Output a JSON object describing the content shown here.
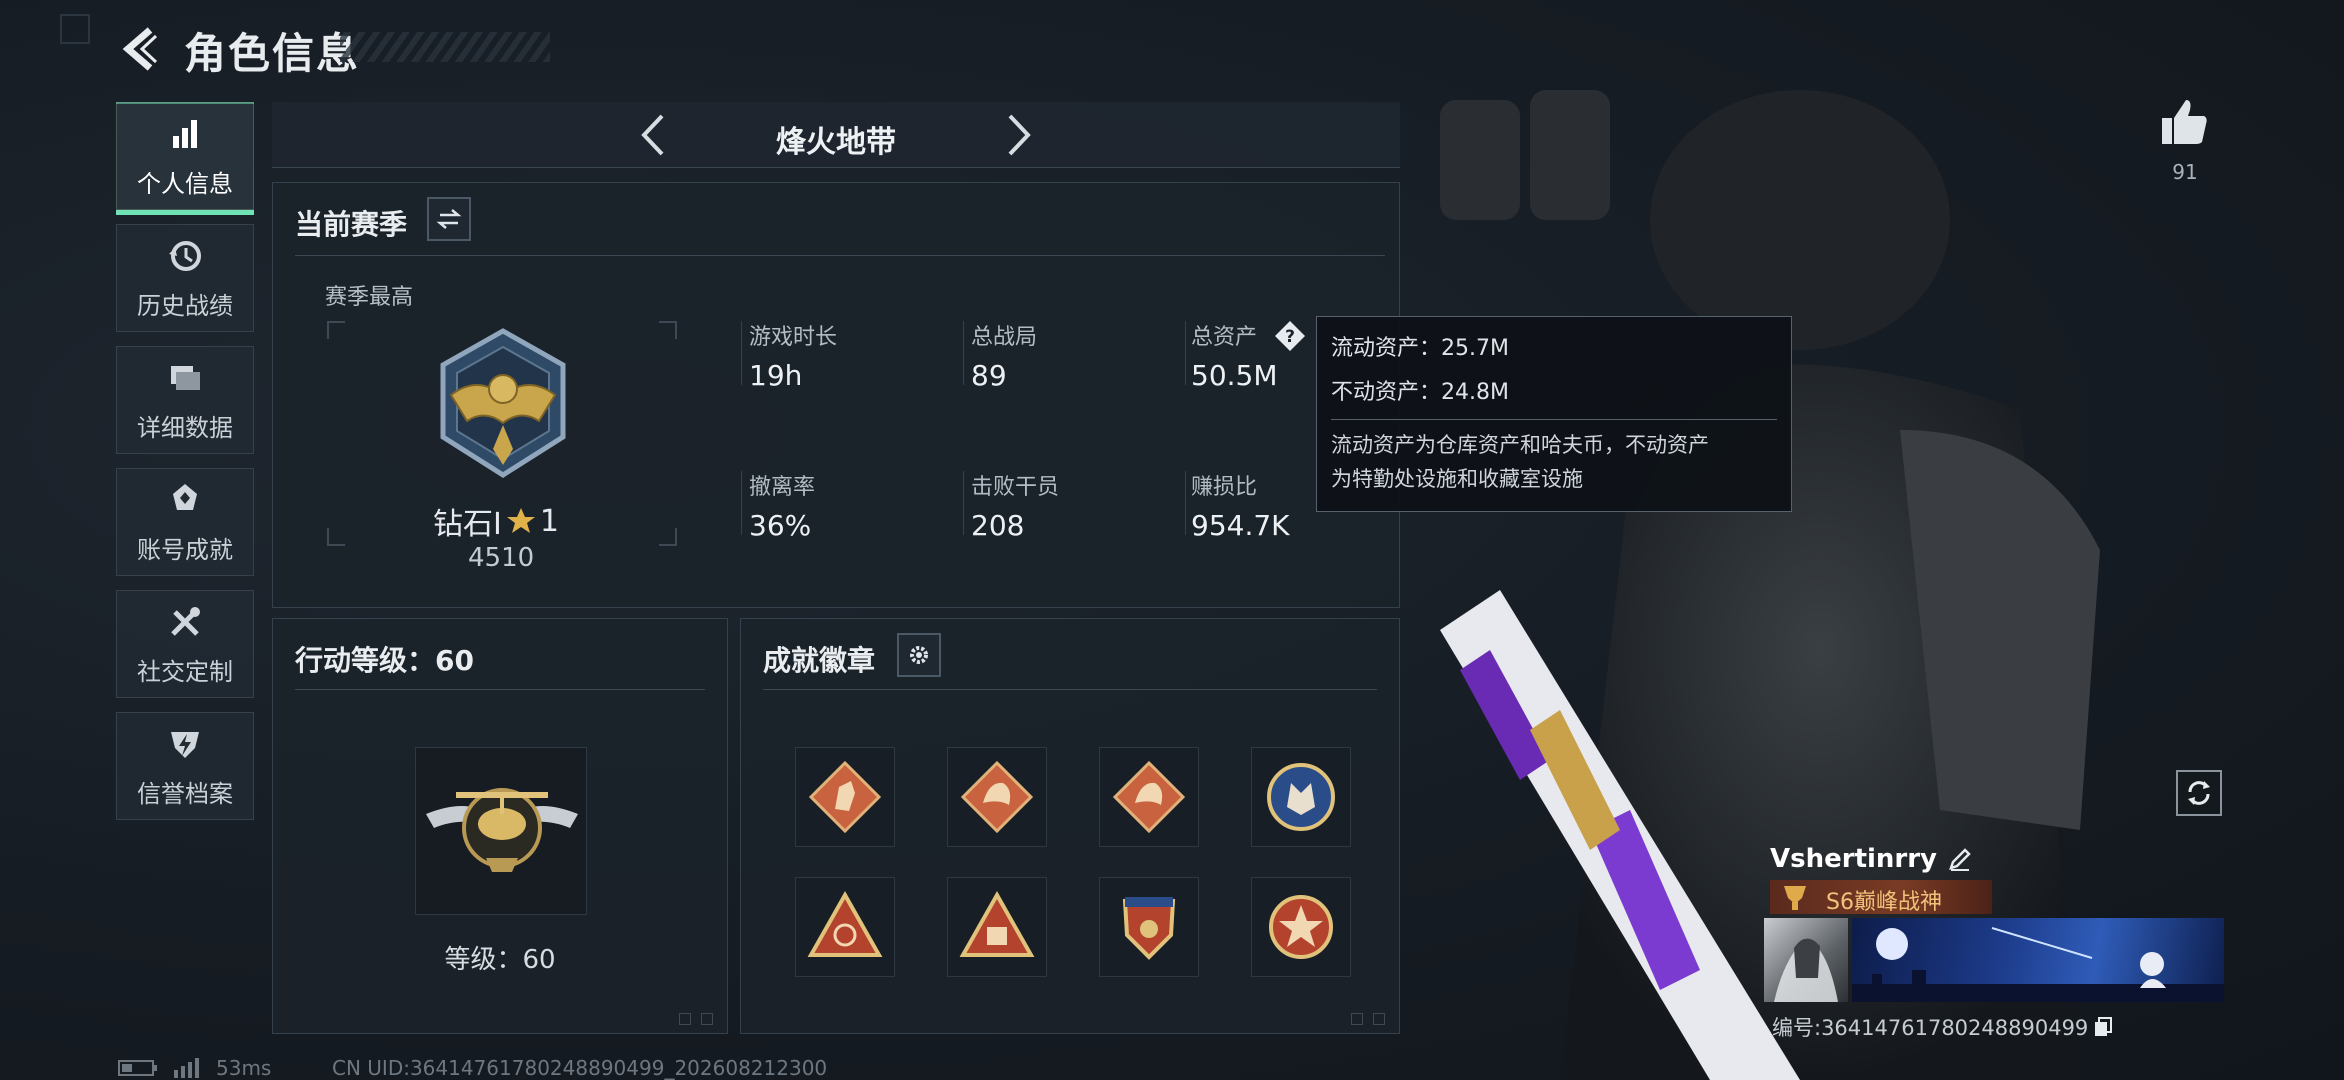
{
  "header": {
    "title": "角色信息"
  },
  "nav": {
    "items": [
      {
        "label": "个人信息",
        "icon": "bar-chart-icon",
        "active": true
      },
      {
        "label": "历史战绩",
        "icon": "history-clock-icon",
        "active": false
      },
      {
        "label": "详细数据",
        "icon": "folder-data-icon",
        "active": false
      },
      {
        "label": "账号成就",
        "icon": "achievement-icon",
        "active": false
      },
      {
        "label": "社交定制",
        "icon": "tools-icon",
        "active": false
      },
      {
        "label": "信誉档案",
        "icon": "shield-lightning-icon",
        "active": false
      }
    ]
  },
  "mode": {
    "title": "烽火地带"
  },
  "season": {
    "heading": "当前赛季",
    "best_label": "赛季最高",
    "rank_name": "钻石Ⅰ",
    "rank_stars": "1",
    "rank_score": "4510",
    "stats": [
      {
        "label": "游戏时长",
        "value": "19h"
      },
      {
        "label": "总战局",
        "value": "89"
      },
      {
        "label": "总资产",
        "value": "50.5M"
      },
      {
        "label": "撤离率",
        "value": "36%"
      },
      {
        "label": "击败干员",
        "value": "208"
      },
      {
        "label": "赚损比",
        "value": "954.7K"
      }
    ]
  },
  "tooltip": {
    "line1": "流动资产：25.7M",
    "line2": "不动资产：24.8M",
    "desc1": "流动资产为仓库资产和哈夫币，不动资产",
    "desc2": "为特勤处设施和收藏室设施"
  },
  "level": {
    "heading": "行动等级：60",
    "text": "等级：60"
  },
  "badges": {
    "heading": "成就徽章",
    "items": [
      {
        "icon": "horse-diamond-badge-icon",
        "color": "#c9623f"
      },
      {
        "icon": "dragon-diamond-badge-icon",
        "color": "#c9623f"
      },
      {
        "icon": "dragon-diamond-badge-icon",
        "color": "#c9623f"
      },
      {
        "icon": "wolf-round-badge-icon",
        "color": "#2a4d8a"
      },
      {
        "icon": "target-triangle-badge-icon",
        "color": "#b4432e"
      },
      {
        "icon": "crate-triangle-badge-icon",
        "color": "#b4432e"
      },
      {
        "icon": "shield-badge-icon",
        "color": "#b4432e"
      },
      {
        "icon": "star-round-badge-icon",
        "color": "#b4432e"
      }
    ]
  },
  "profile": {
    "like_count": "91",
    "player_name": "Vshertinrry",
    "title_badge": "S6巅峰战神",
    "player_id": "编号:3641476178024889049​9"
  },
  "status": {
    "ping": "53ms",
    "uid": "CN UID:36414761780248890499_202608212300"
  },
  "colors": {
    "accent": "#6fe3b6",
    "panel": "#1b222a",
    "border": "#34404b"
  }
}
